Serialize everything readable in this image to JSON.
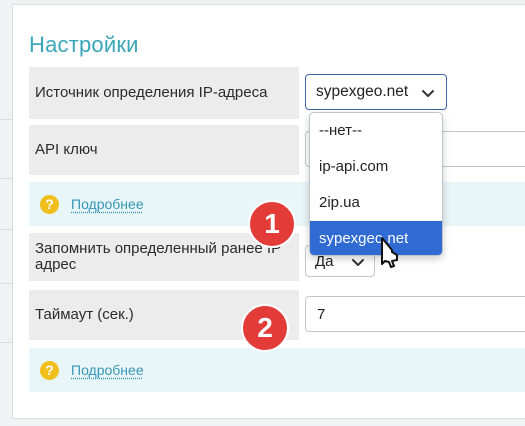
{
  "page_title": "Настройки",
  "fields": {
    "ip_source": {
      "label": "Источник определения IP-адреса",
      "value": "sypexgeo.net"
    },
    "api_key": {
      "label": "API ключ"
    },
    "remember_ip": {
      "label": "Запомнить определенный ранее IP адрес",
      "value": "Да"
    },
    "timeout": {
      "label": "Таймаут (сек.)",
      "value": "7"
    }
  },
  "help": {
    "icon_glyph": "?",
    "link_label": "Подробнее"
  },
  "dropdown": {
    "options": [
      "--нет--",
      "ip-api.com",
      "2ip.ua",
      "sypexgeo.net"
    ],
    "selected": "sypexgeo.net",
    "highlight_color": "#2f6bd3"
  },
  "annotations": [
    "1",
    "2"
  ],
  "colors": {
    "accent": "#3aa6b9",
    "link": "#3596b5",
    "badge": "#e33b38",
    "help_icon": "#f1bf1b"
  }
}
